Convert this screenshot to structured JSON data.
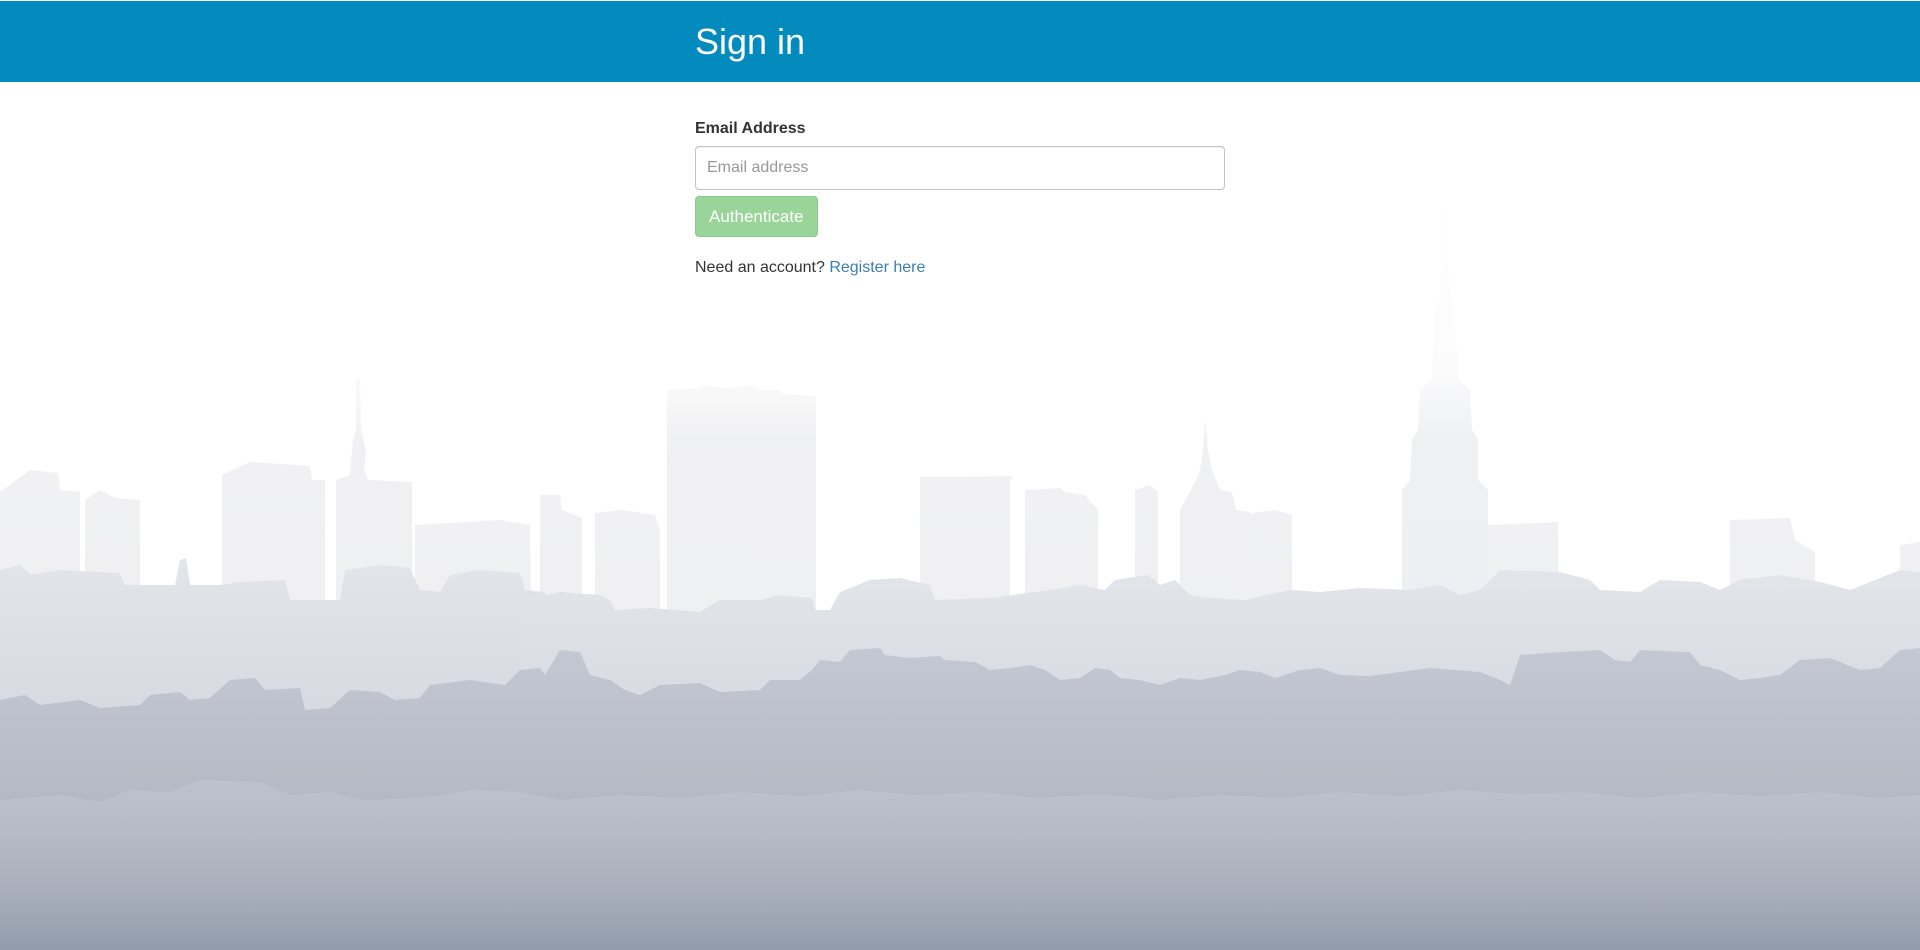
{
  "header": {
    "title": "Sign in",
    "bar_color": "#028bbc"
  },
  "form": {
    "email_label": "Email Address",
    "email_placeholder": "Email address",
    "email_value": "",
    "submit_label": "Authenticate",
    "submit_color": "#99d499"
  },
  "footer_prompt": {
    "text": "Need an account?",
    "link_label": "Register here",
    "link_color": "#3a7fb5"
  },
  "background": {
    "image": "city-skyline-illustration"
  }
}
